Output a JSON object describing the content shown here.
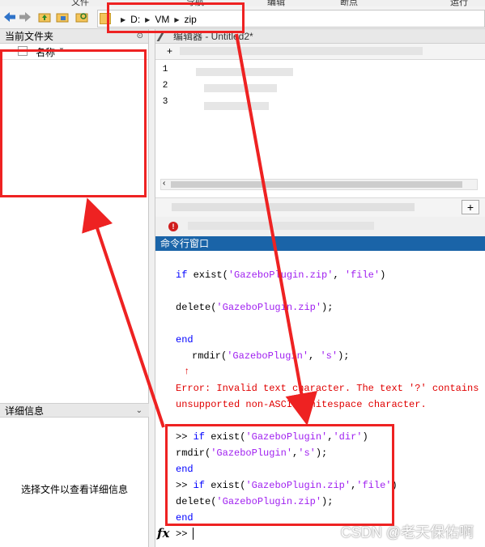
{
  "menubar": {
    "items": [
      "文件",
      "导航",
      "编辑",
      "断点",
      "运行"
    ]
  },
  "address_bar": {
    "crumbs": [
      "D:",
      "VM",
      "zip"
    ]
  },
  "current_folder_panel": {
    "title": "当前文件夹",
    "column_name": "名称"
  },
  "details_panel": {
    "title": "详细信息",
    "message": "选择文件以查看详细信息"
  },
  "editor": {
    "title": "编辑器 - Untitled2*",
    "new_tab": "+",
    "line_numbers": [
      "1",
      "2",
      "3"
    ],
    "add_tab": "+"
  },
  "command_window": {
    "title": "命令行窗口",
    "prompt": ">>",
    "lines": [
      {
        "kw": "if",
        "rest_1": " exist(",
        "str_1": "'GazeboPlugin.zip'",
        "rest_2": ", ",
        "str_2": "'file'",
        "rest_3": ")"
      },
      {
        "rest_1": "delete(",
        "str_1": "'GazeboPlugin.zip'",
        "rest_2": ");"
      },
      {
        "kw": "end"
      },
      {
        "rest_1": "rmdir(",
        "str_1": "'GazeboPlugin'",
        "rest_2": ", ",
        "str_2": "'s'",
        "rest_3": ");"
      },
      {
        "marker": "↑"
      },
      {
        "error_1": "Error: Invalid text character. The text '?' contains an",
        "error_2": "unsupported non-ASCII whitespace character."
      },
      {
        "prompt": ">>",
        "kw": "if",
        "rest_1": " exist(",
        "str_1": "'GazeboPlugin'",
        "rest_2": ",",
        "str_2": "'dir'",
        "rest_3": ")"
      },
      {
        "rest_1": "rmdir(",
        "str_1": "'GazeboPlugin'",
        "rest_2": ",",
        "str_2": "'s'",
        "rest_3": ");"
      },
      {
        "kw": "end"
      },
      {
        "prompt": ">>",
        "kw": "if",
        "rest_1": " exist(",
        "str_1": "'GazeboPlugin.zip'",
        "rest_2": ",",
        "str_2": "'file'",
        "rest_3": ")"
      },
      {
        "rest_1": "delete(",
        "str_1": "'GazeboPlugin.zip'",
        "rest_2": ");"
      },
      {
        "kw": "end"
      }
    ],
    "fx_label": "fx"
  },
  "watermark": "CSDN @老天保佑啊",
  "colors": {
    "annotation_red": "#ee2222",
    "cmd_title_bg": "#1a64a8",
    "keyword": "#0000ff",
    "string": "#a020f0",
    "error": "#e00000"
  }
}
